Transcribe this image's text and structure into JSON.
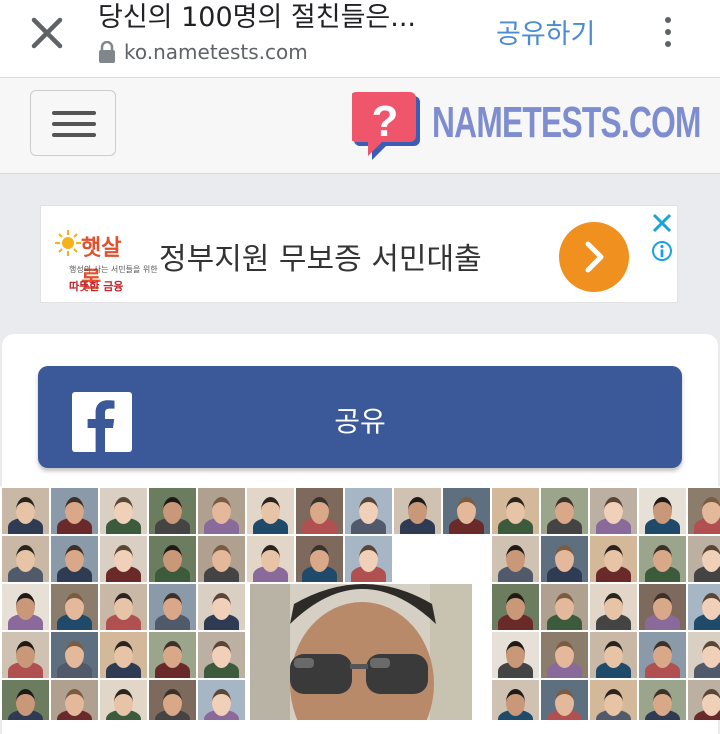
{
  "browser": {
    "title": "당신의 100명의 절친들은...",
    "url": "ko.nametests.com",
    "share_label": "공유하기",
    "icons": {
      "close": "close-icon",
      "lock": "lock-icon",
      "more": "more-vert-icon"
    }
  },
  "site": {
    "logo_text": "NAMETESTS.COM",
    "logo_color": "#7d8dd0",
    "icons": {
      "menu": "hamburger-menu-icon",
      "logo": "question-bubble-logo-icon"
    }
  },
  "ad": {
    "brand_name": "햇살론",
    "brand_slogan": "행성의 사는 서민들을 위한",
    "brand_sub": "따뜻한 금융",
    "headline": "정부지원 무보증 서민대출",
    "cta_color": "#f0901e",
    "icons": {
      "cta": "chevron-right-icon",
      "close": "ad-close-icon",
      "info": "ad-info-icon"
    }
  },
  "share_button": {
    "label": "공유",
    "color": "#3b5998",
    "icon": "facebook-icon"
  },
  "collage": {
    "description_icon": "friends-photo-grid"
  }
}
